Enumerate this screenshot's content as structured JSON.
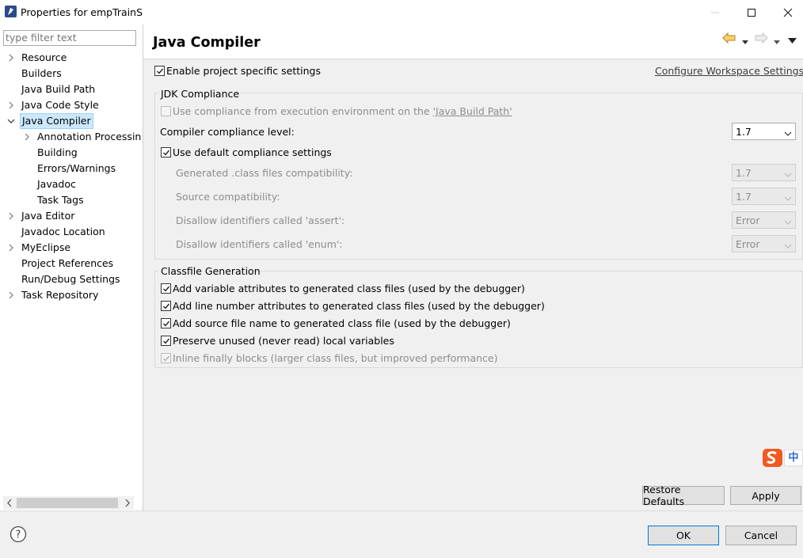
{
  "window": {
    "title": "Properties for empTrainS",
    "controls": [
      "minimize-icon",
      "maximize-icon",
      "close-icon"
    ]
  },
  "sidebar": {
    "filter_placeholder": "type filter text",
    "items": [
      {
        "label": "Resource",
        "expandable": true,
        "expanded": false,
        "level": 0
      },
      {
        "label": "Builders",
        "expandable": false,
        "level": 0
      },
      {
        "label": "Java Build Path",
        "expandable": false,
        "level": 0
      },
      {
        "label": "Java Code Style",
        "expandable": true,
        "expanded": false,
        "level": 0
      },
      {
        "label": "Java Compiler",
        "expandable": true,
        "expanded": true,
        "level": 0,
        "selected": true
      },
      {
        "label": "Annotation Processin",
        "expandable": true,
        "expanded": false,
        "level": 1
      },
      {
        "label": "Building",
        "expandable": false,
        "level": 1
      },
      {
        "label": "Errors/Warnings",
        "expandable": false,
        "level": 1
      },
      {
        "label": "Javadoc",
        "expandable": false,
        "level": 1
      },
      {
        "label": "Task Tags",
        "expandable": false,
        "level": 1
      },
      {
        "label": "Java Editor",
        "expandable": true,
        "expanded": false,
        "level": 0
      },
      {
        "label": "Javadoc Location",
        "expandable": false,
        "level": 0
      },
      {
        "label": "MyEclipse",
        "expandable": true,
        "expanded": false,
        "level": 0
      },
      {
        "label": "Project References",
        "expandable": false,
        "level": 0
      },
      {
        "label": "Run/Debug Settings",
        "expandable": false,
        "level": 0
      },
      {
        "label": "Task Repository",
        "expandable": true,
        "expanded": false,
        "level": 0
      }
    ]
  },
  "page": {
    "title": "Java Compiler",
    "nav_icons": [
      "back-arrow-icon",
      "forward-arrow-icon",
      "view-menu-icon"
    ],
    "enable_project_specific": {
      "label": "Enable project specific settings",
      "checked": true
    },
    "configure_link": "Configure Workspace Settings...",
    "jdk_group": {
      "title": "JDK Compliance",
      "use_exec_env": {
        "label": "Use compliance from execution environment on the ",
        "link": "'Java Build Path'",
        "checked": false,
        "disabled": true
      },
      "compliance_level": {
        "label": "Compiler compliance level:",
        "value": "1.7"
      },
      "use_default": {
        "label": "Use default compliance settings",
        "checked": true
      },
      "generated_class": {
        "label": "Generated .class files compatibility:",
        "value": "1.7"
      },
      "source_compat": {
        "label": "Source compatibility:",
        "value": "1.7"
      },
      "disallow_assert": {
        "label": "Disallow identifiers called 'assert':",
        "value": "Error"
      },
      "disallow_enum": {
        "label": "Disallow identifiers called 'enum':",
        "value": "Error"
      }
    },
    "classfile_group": {
      "title": "Classfile Generation",
      "options": [
        {
          "label": "Add variable attributes to generated class files (used by the debugger)",
          "checked": true,
          "disabled": false
        },
        {
          "label": "Add line number attributes to generated class files (used by the debugger)",
          "checked": true,
          "disabled": false
        },
        {
          "label": "Add source file name to generated class file (used by the debugger)",
          "checked": true,
          "disabled": false
        },
        {
          "label": "Preserve unused (never read) local variables",
          "checked": true,
          "disabled": false
        },
        {
          "label": "Inline finally blocks (larger class files, but improved performance)",
          "checked": true,
          "disabled": true
        }
      ]
    },
    "restore_defaults": "Restore Defaults",
    "apply": "Apply",
    "ime_indicator": "中"
  },
  "footer": {
    "help_icon": "help-icon",
    "ok": "OK",
    "cancel": "Cancel"
  },
  "colors": {
    "selection_bg": "#cce8ff",
    "selection_border": "#99d1ff",
    "ok_border": "#0078d7",
    "ime_orange": "#f05a22",
    "ime_blue": "#2a6ed6"
  }
}
